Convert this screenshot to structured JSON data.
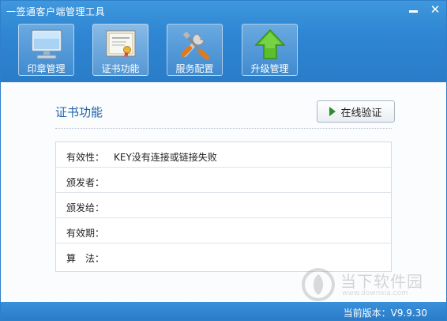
{
  "window": {
    "title": "一签通客户端管理工具",
    "minimize_glyph": "–",
    "close_glyph": "✕"
  },
  "toolbar": [
    {
      "label": "印章管理",
      "icon": "monitor-icon"
    },
    {
      "label": "证书功能",
      "icon": "certificate-icon",
      "active": true
    },
    {
      "label": "服务配置",
      "icon": "tools-icon"
    },
    {
      "label": "升级管理",
      "icon": "upgrade-arrow-icon"
    }
  ],
  "main": {
    "section_title": "证书功能",
    "verify_button": "在线验证",
    "fields": [
      {
        "label": "有效性：",
        "value": "KEY没有连接或链接失败"
      },
      {
        "label": "颁发者：",
        "value": ""
      },
      {
        "label": "颁发给：",
        "value": ""
      },
      {
        "label": "有效期：",
        "value": ""
      },
      {
        "label": "算　法：",
        "value": ""
      }
    ]
  },
  "watermark": {
    "title": "当下软件园",
    "subtitle": "www.downxia.com"
  },
  "status": {
    "version": "当前版本：V9.9.30"
  },
  "colors": {
    "header": "#2f86d3",
    "section_title": "#1f63a8",
    "play_icon": "#2e8b2e"
  }
}
